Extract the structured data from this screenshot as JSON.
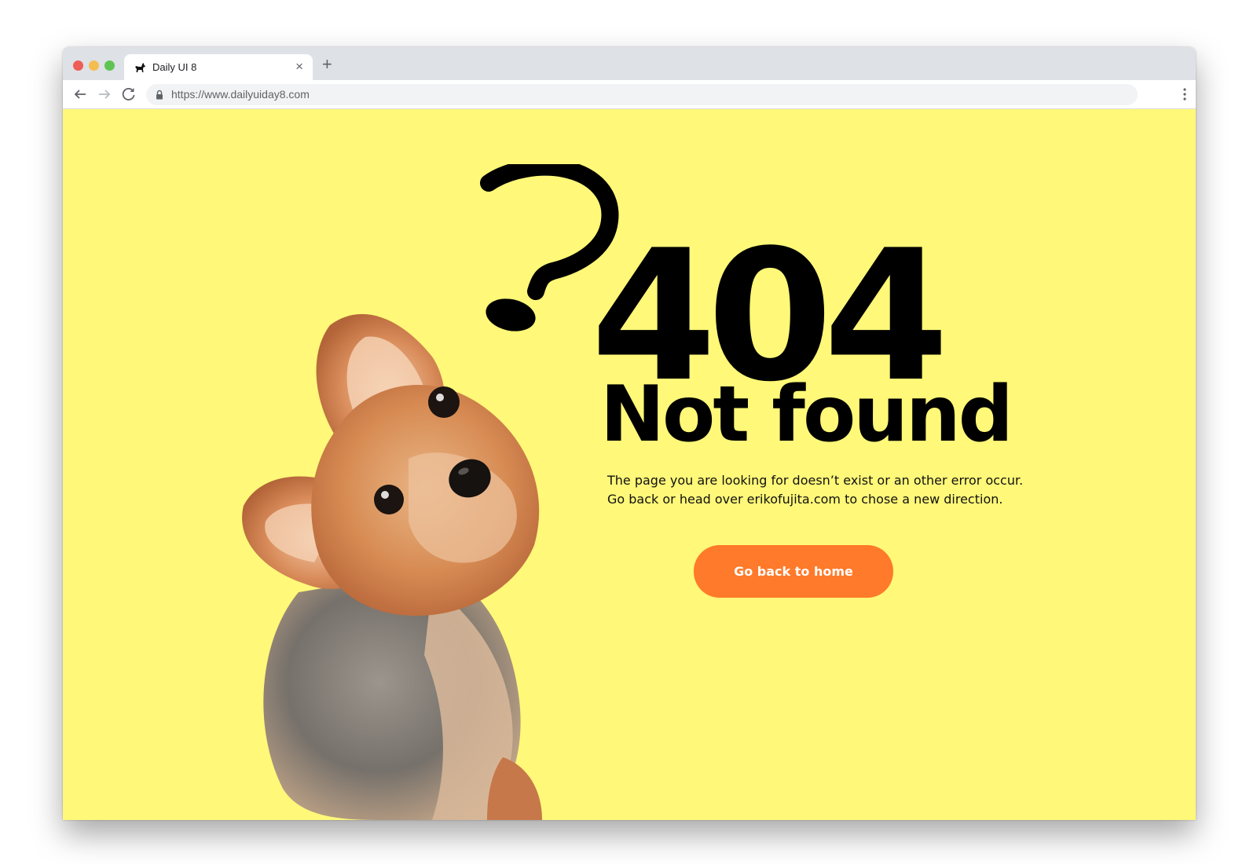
{
  "browser": {
    "tab_title": "Daily UI 8",
    "url": "https://www.dailyuiday8.com",
    "icons": {
      "favicon": "dog-icon",
      "tab_close": "close-icon",
      "new_tab": "plus-icon",
      "back": "arrow-left-icon",
      "forward": "arrow-right-icon",
      "reload": "reload-icon",
      "lock": "lock-icon",
      "menu": "kebab-menu-icon"
    },
    "tab_close_glyph": "×",
    "new_tab_glyph": "+"
  },
  "page": {
    "background_color": "#fff878",
    "accent_color": "#ff7a2a",
    "error_code": "404",
    "heading": "Not found",
    "message_lines": [
      "The page you are looking for doesn’t exist or an other error occur.",
      "Go back or head over erikofujita.com to chose a new direction."
    ],
    "button_label": "Go back to home"
  }
}
